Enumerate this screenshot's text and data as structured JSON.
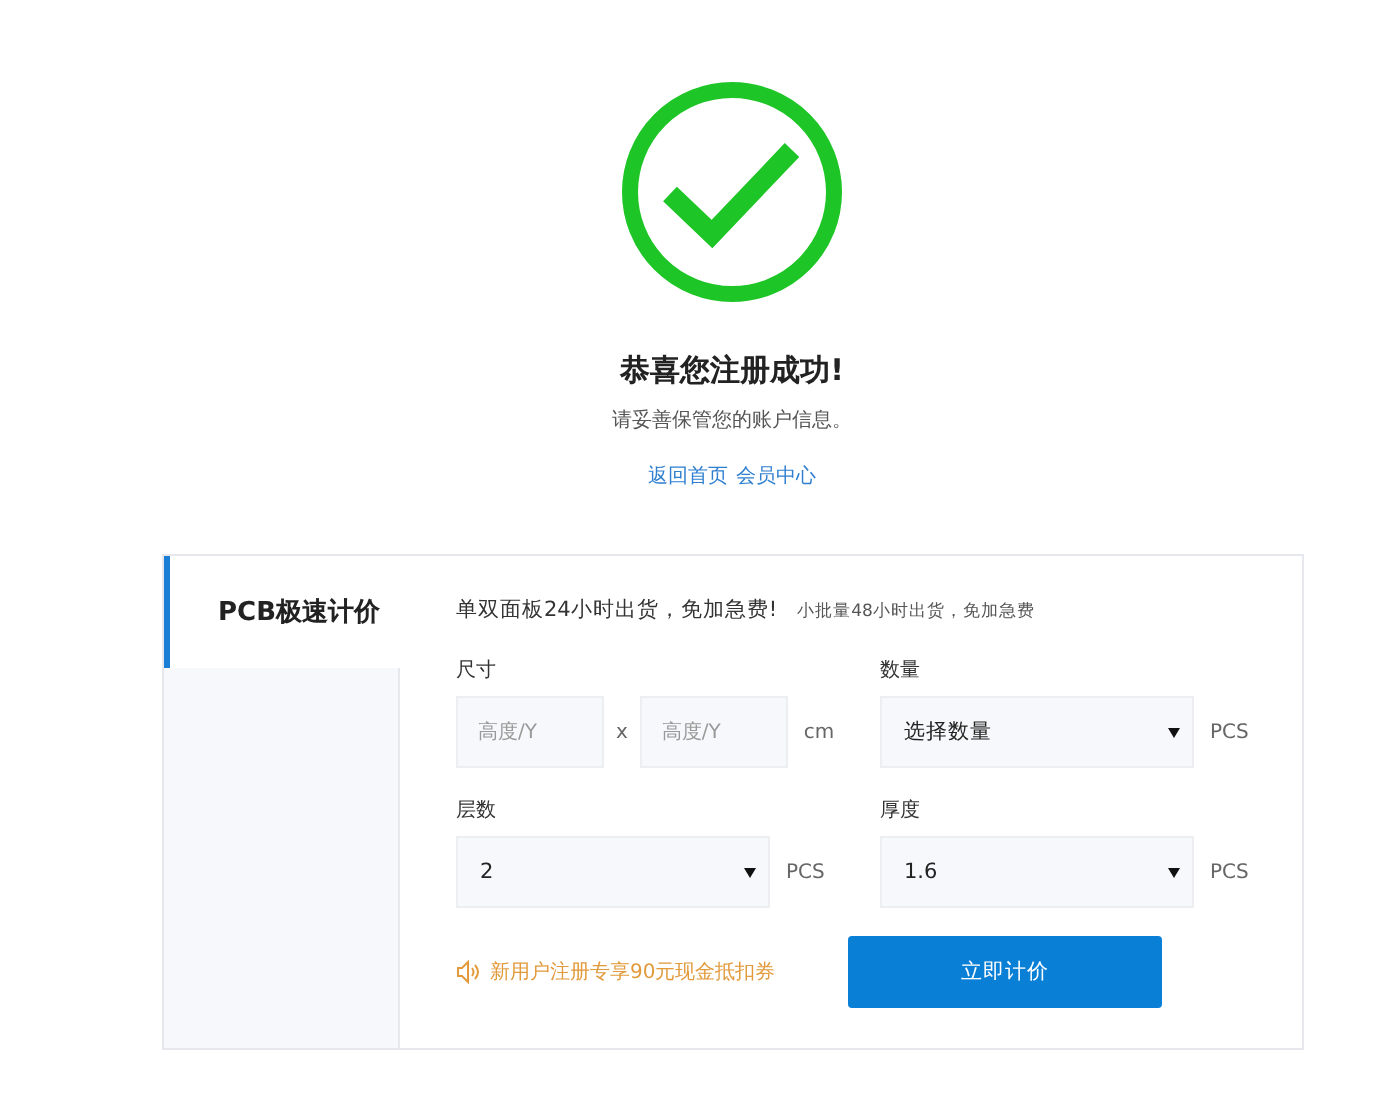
{
  "success": {
    "title": "恭喜您注册成功!",
    "message": "请妥善保管您的账户信息。",
    "links": [
      "返回首页",
      "会员中心"
    ]
  },
  "quote": {
    "tab": {
      "label": "PCB极速计价",
      "selected": true
    },
    "headline": "单双面板24小时出货，免加急费!",
    "subline": "小批量48小时出货，免加急费",
    "size": {
      "label": "尺寸",
      "fields": [
        {
          "placeholder": "高度/Y"
        },
        {
          "placeholder": "高度/Y"
        }
      ],
      "separator": "x",
      "unit": "cm"
    },
    "selects": [
      {
        "label": "数量",
        "value": "选择数量",
        "unit": "PCS"
      },
      {
        "label": "层数",
        "value": "2",
        "unit": "PCS"
      },
      {
        "label": "厚度",
        "value": "1.6",
        "unit": "PCS"
      }
    ],
    "promo": "新用户注册专享90元现金抵扣券",
    "button": "立即计价"
  }
}
